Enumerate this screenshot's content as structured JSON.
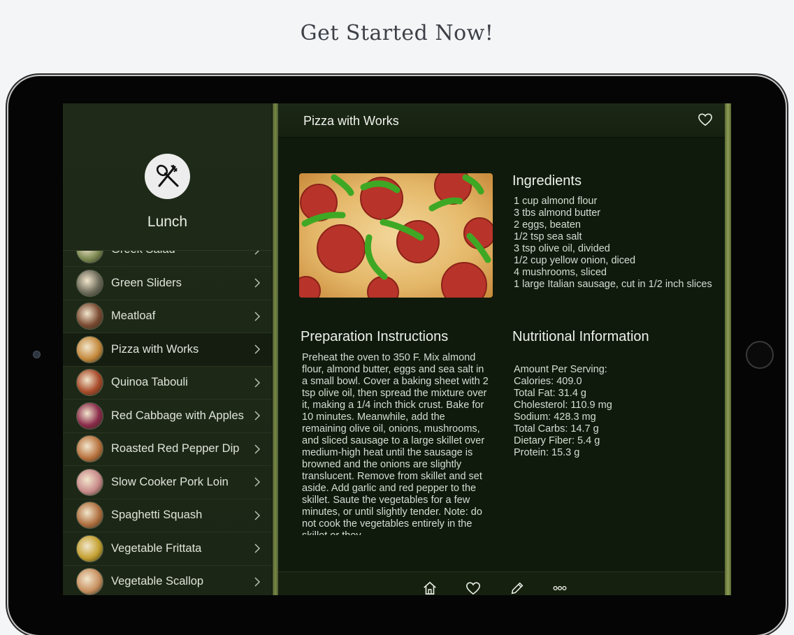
{
  "headline": "Get Started Now!",
  "sidebar": {
    "category": "Lunch",
    "items": [
      {
        "label": "Greek Salad",
        "thumb_color": "#7d8a52"
      },
      {
        "label": "Green Sliders",
        "thumb_color": "#6c6a5a"
      },
      {
        "label": "Meatloaf",
        "thumb_color": "#7a4a32"
      },
      {
        "label": "Pizza with Works",
        "thumb_color": "#c4893c"
      },
      {
        "label": "Quinoa Tabouli",
        "thumb_color": "#a84a2a"
      },
      {
        "label": "Red Cabbage with Apples",
        "thumb_color": "#8a2a4a"
      },
      {
        "label": "Roasted Red Pepper Dip",
        "thumb_color": "#b8723e"
      },
      {
        "label": "Slow Cooker Pork Loin",
        "thumb_color": "#c88a8a"
      },
      {
        "label": "Spaghetti Squash",
        "thumb_color": "#b07040"
      },
      {
        "label": "Vegetable Frittata",
        "thumb_color": "#c4a030"
      },
      {
        "label": "Vegetable Scallop",
        "thumb_color": "#c89060"
      }
    ],
    "active_index": 3
  },
  "recipe": {
    "title": "Pizza with Works",
    "ingredients_title": "Ingredients",
    "ingredients": [
      "1 cup almond flour",
      "3 tbs almond butter",
      "2 eggs, beaten",
      "1/2 tsp sea salt",
      "3 tsp olive oil, divided",
      "1/2 cup yellow onion, diced",
      "4 mushrooms, sliced",
      "1 large Italian sausage, cut in 1/2 inch slices"
    ],
    "prep_title": "Preparation Instructions",
    "prep_text": "Preheat the oven to 350 F. Mix almond flour, almond butter, eggs and sea salt in a small bowl. Cover a baking sheet with 2 tsp olive oil, then spread the mixture over it, making a 1/4 inch thick crust. Bake for 10 minutes. Meanwhile, add the remaining olive oil, onions, mushrooms, and sliced sausage to a large skillet over medium-high heat until the sausage is browned and the onions are slightly translucent. Remove from skillet and set aside. Add garlic and red pepper to the skillet. Saute  the vegetables for a few minutes, or until slightly tender. Note: do not cook the vegetables entirely in the skillet or they",
    "nutrition_title": "Nutritional Information",
    "nutrition": [
      "Amount Per Serving:",
      "Calories: 409.0",
      "Total Fat: 31.4 g",
      "Cholesterol: 110.9 mg",
      "Sodium: 428.3 mg",
      "Total Carbs: 14.7 g",
      "Dietary Fiber: 5.4 g",
      "Protein: 15.3 g"
    ]
  },
  "toolbar_icons": [
    "home-icon",
    "heart-icon",
    "pencil-icon",
    "more-icon"
  ]
}
